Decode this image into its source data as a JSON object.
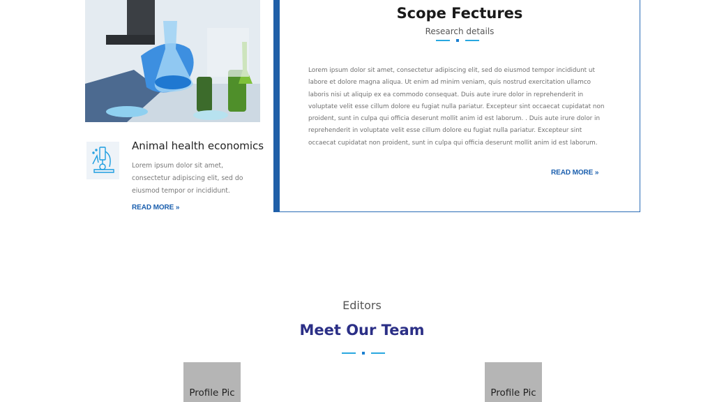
{
  "feature": {
    "title": "Animal health economics",
    "text": "Lorem ipsum dolor sit amet, consectetur adipiscing elit, sed do eiusmod tempor or incididunt.",
    "read_more": "READ MORE »"
  },
  "scope": {
    "title": "Scope Fectures",
    "subtitle": "Research details",
    "body": "Lorem ipsum dolor sit amet, consectetur adipiscing elit, sed do eiusmod tempor incididunt ut labore et dolore magna aliqua. Ut enim ad minim veniam, quis nostrud exercitation ullamco laboris nisi ut aliquip ex ea commodo consequat. Duis aute irure dolor in reprehenderit in voluptate velit esse cillum dolore eu fugiat nulla pariatur. Excepteur sint occaecat cupidatat non proident, sunt in culpa qui officia deserunt mollit anim id est laborum. . Duis aute irure dolor in reprehenderit in voluptate velit esse cillum dolore eu fugiat nulla pariatur. Excepteur sint occaecat cupidatat non proident, sunt in culpa qui officia deserunt mollit anim id est laborum.",
    "read_more": "READ MORE »"
  },
  "team": {
    "eyebrow": "Editors",
    "title": "Meet Our Team",
    "members": [
      {
        "label": "Profile Pic"
      },
      {
        "label": "Profile Pic"
      }
    ]
  },
  "colors": {
    "accent_blue": "#1f5fa8",
    "team_title": "#2b2f86",
    "divider": "#29a8e0"
  }
}
